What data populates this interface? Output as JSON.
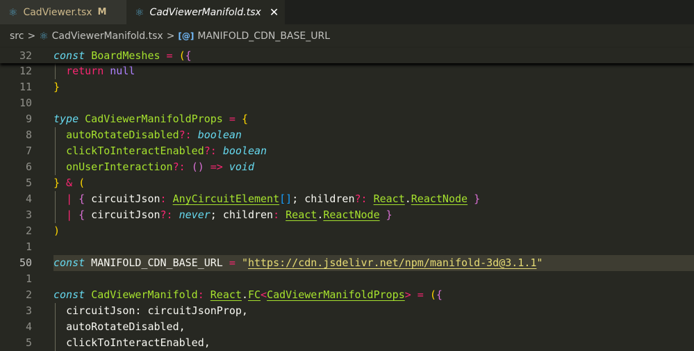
{
  "tabs": [
    {
      "label": "CadViewer.tsx",
      "badge": "M",
      "icon": "react-icon"
    },
    {
      "label": "CadViewerManifold.tsx",
      "close": "✕",
      "icon": "react-icon"
    }
  ],
  "breadcrumb": {
    "folder": "src",
    "file": "CadViewerManifold.tsx",
    "symbol": "MANIFOLD_CDN_BASE_URL",
    "sep": ">"
  },
  "sticky": {
    "num": "32",
    "tokens": [
      [
        "kw",
        "const"
      ],
      [
        "",
        "·"
      ],
      [
        "ty",
        "BoardMeshes"
      ],
      [
        "",
        ""
      ],
      [
        "op",
        " = "
      ],
      [
        "b1",
        "("
      ],
      [
        "b2",
        "{"
      ]
    ]
  },
  "lines": [
    {
      "num": "12",
      "indent": 1,
      "tokens": [
        [
          "op",
          "return"
        ],
        [
          "",
          " "
        ],
        [
          "nu",
          "null"
        ]
      ]
    },
    {
      "num": "11",
      "indent": 0,
      "tokens": [
        [
          "b1",
          "}"
        ]
      ]
    },
    {
      "num": "10",
      "indent": 0,
      "tokens": []
    },
    {
      "num": "9",
      "indent": 0,
      "tokens": [
        [
          "kw",
          "type"
        ],
        [
          "",
          " "
        ],
        [
          "ty",
          "CadViewerManifoldProps"
        ],
        [
          "op",
          " = "
        ],
        [
          "b1",
          "{"
        ]
      ]
    },
    {
      "num": "8",
      "indent": 1,
      "tokens": [
        [
          "ty",
          "autoRotateDisabled"
        ],
        [
          "op",
          "?:"
        ],
        [
          "",
          " "
        ],
        [
          "it",
          "boolean"
        ]
      ]
    },
    {
      "num": "7",
      "indent": 1,
      "tokens": [
        [
          "ty",
          "clickToInteractEnabled"
        ],
        [
          "op",
          "?:"
        ],
        [
          "",
          " "
        ],
        [
          "it",
          "boolean"
        ]
      ]
    },
    {
      "num": "6",
      "indent": 1,
      "tokens": [
        [
          "ty",
          "onUserInteraction"
        ],
        [
          "op",
          "?:"
        ],
        [
          "",
          " "
        ],
        [
          "b2",
          "()"
        ],
        [
          "op",
          " => "
        ],
        [
          "it",
          "void"
        ]
      ]
    },
    {
      "num": "5",
      "indent": 0,
      "tokens": [
        [
          "b1",
          "}"
        ],
        [
          "op",
          " & "
        ],
        [
          "b1",
          "("
        ]
      ]
    },
    {
      "num": "4",
      "indent": 1,
      "tokens": [
        [
          "op",
          "|"
        ],
        [
          "",
          " "
        ],
        [
          "b2",
          "{"
        ],
        [
          "",
          " circuitJson"
        ],
        [
          "op",
          ":"
        ],
        [
          "",
          " "
        ],
        [
          "ty u",
          "AnyCircuitElement"
        ],
        [
          "b3",
          "[]"
        ],
        [
          "",
          "; children"
        ],
        [
          "op",
          "?:"
        ],
        [
          "",
          " "
        ],
        [
          "ty u",
          "React"
        ],
        [
          "",
          "."
        ],
        [
          "ty u",
          "ReactNode"
        ],
        [
          "",
          " "
        ],
        [
          "b2",
          "}"
        ]
      ]
    },
    {
      "num": "3",
      "indent": 1,
      "tokens": [
        [
          "op",
          "|"
        ],
        [
          "",
          " "
        ],
        [
          "b2",
          "{"
        ],
        [
          "",
          " circuitJson"
        ],
        [
          "op",
          "?:"
        ],
        [
          "",
          " "
        ],
        [
          "it",
          "never"
        ],
        [
          "",
          "; children"
        ],
        [
          "op",
          ":"
        ],
        [
          "",
          " "
        ],
        [
          "ty u",
          "React"
        ],
        [
          "",
          "."
        ],
        [
          "ty u",
          "ReactNode"
        ],
        [
          "",
          " "
        ],
        [
          "b2",
          "}"
        ]
      ]
    },
    {
      "num": "2",
      "indent": 0,
      "tokens": [
        [
          "b1",
          ")"
        ]
      ]
    },
    {
      "num": "1",
      "indent": 0,
      "tokens": []
    },
    {
      "num": "50",
      "indent": 0,
      "current": true,
      "tokens": [
        [
          "kw",
          "const"
        ],
        [
          "",
          " MANIFOLD_CDN_BASE_URL"
        ],
        [
          "op",
          " = "
        ],
        [
          "st",
          "\""
        ],
        [
          "st us",
          "https://cdn.jsdelivr.net/npm/manifold-3d@3.1.1"
        ],
        [
          "st",
          "\""
        ]
      ]
    },
    {
      "num": "1",
      "indent": 0,
      "tokens": []
    },
    {
      "num": "2",
      "indent": 0,
      "tokens": [
        [
          "kw",
          "const"
        ],
        [
          "",
          " "
        ],
        [
          "ty",
          "CadViewerManifold"
        ],
        [
          "op",
          ":"
        ],
        [
          "",
          " "
        ],
        [
          "ty u",
          "React"
        ],
        [
          "",
          "."
        ],
        [
          "ty u",
          "FC"
        ],
        [
          "op",
          "<"
        ],
        [
          "ty u",
          "CadViewerManifoldProps"
        ],
        [
          "op",
          ">"
        ],
        [
          "op",
          " = "
        ],
        [
          "b1",
          "("
        ],
        [
          "b2",
          "{"
        ]
      ]
    },
    {
      "num": "3",
      "indent": 1,
      "tokens": [
        [
          "",
          "circuitJson: circuitJsonProp,"
        ]
      ]
    },
    {
      "num": "4",
      "indent": 1,
      "tokens": [
        [
          "",
          "autoRotateDisabled,"
        ]
      ]
    },
    {
      "num": "5",
      "indent": 1,
      "tokens": [
        [
          "",
          "clickToInteractEnabled,"
        ]
      ]
    }
  ]
}
